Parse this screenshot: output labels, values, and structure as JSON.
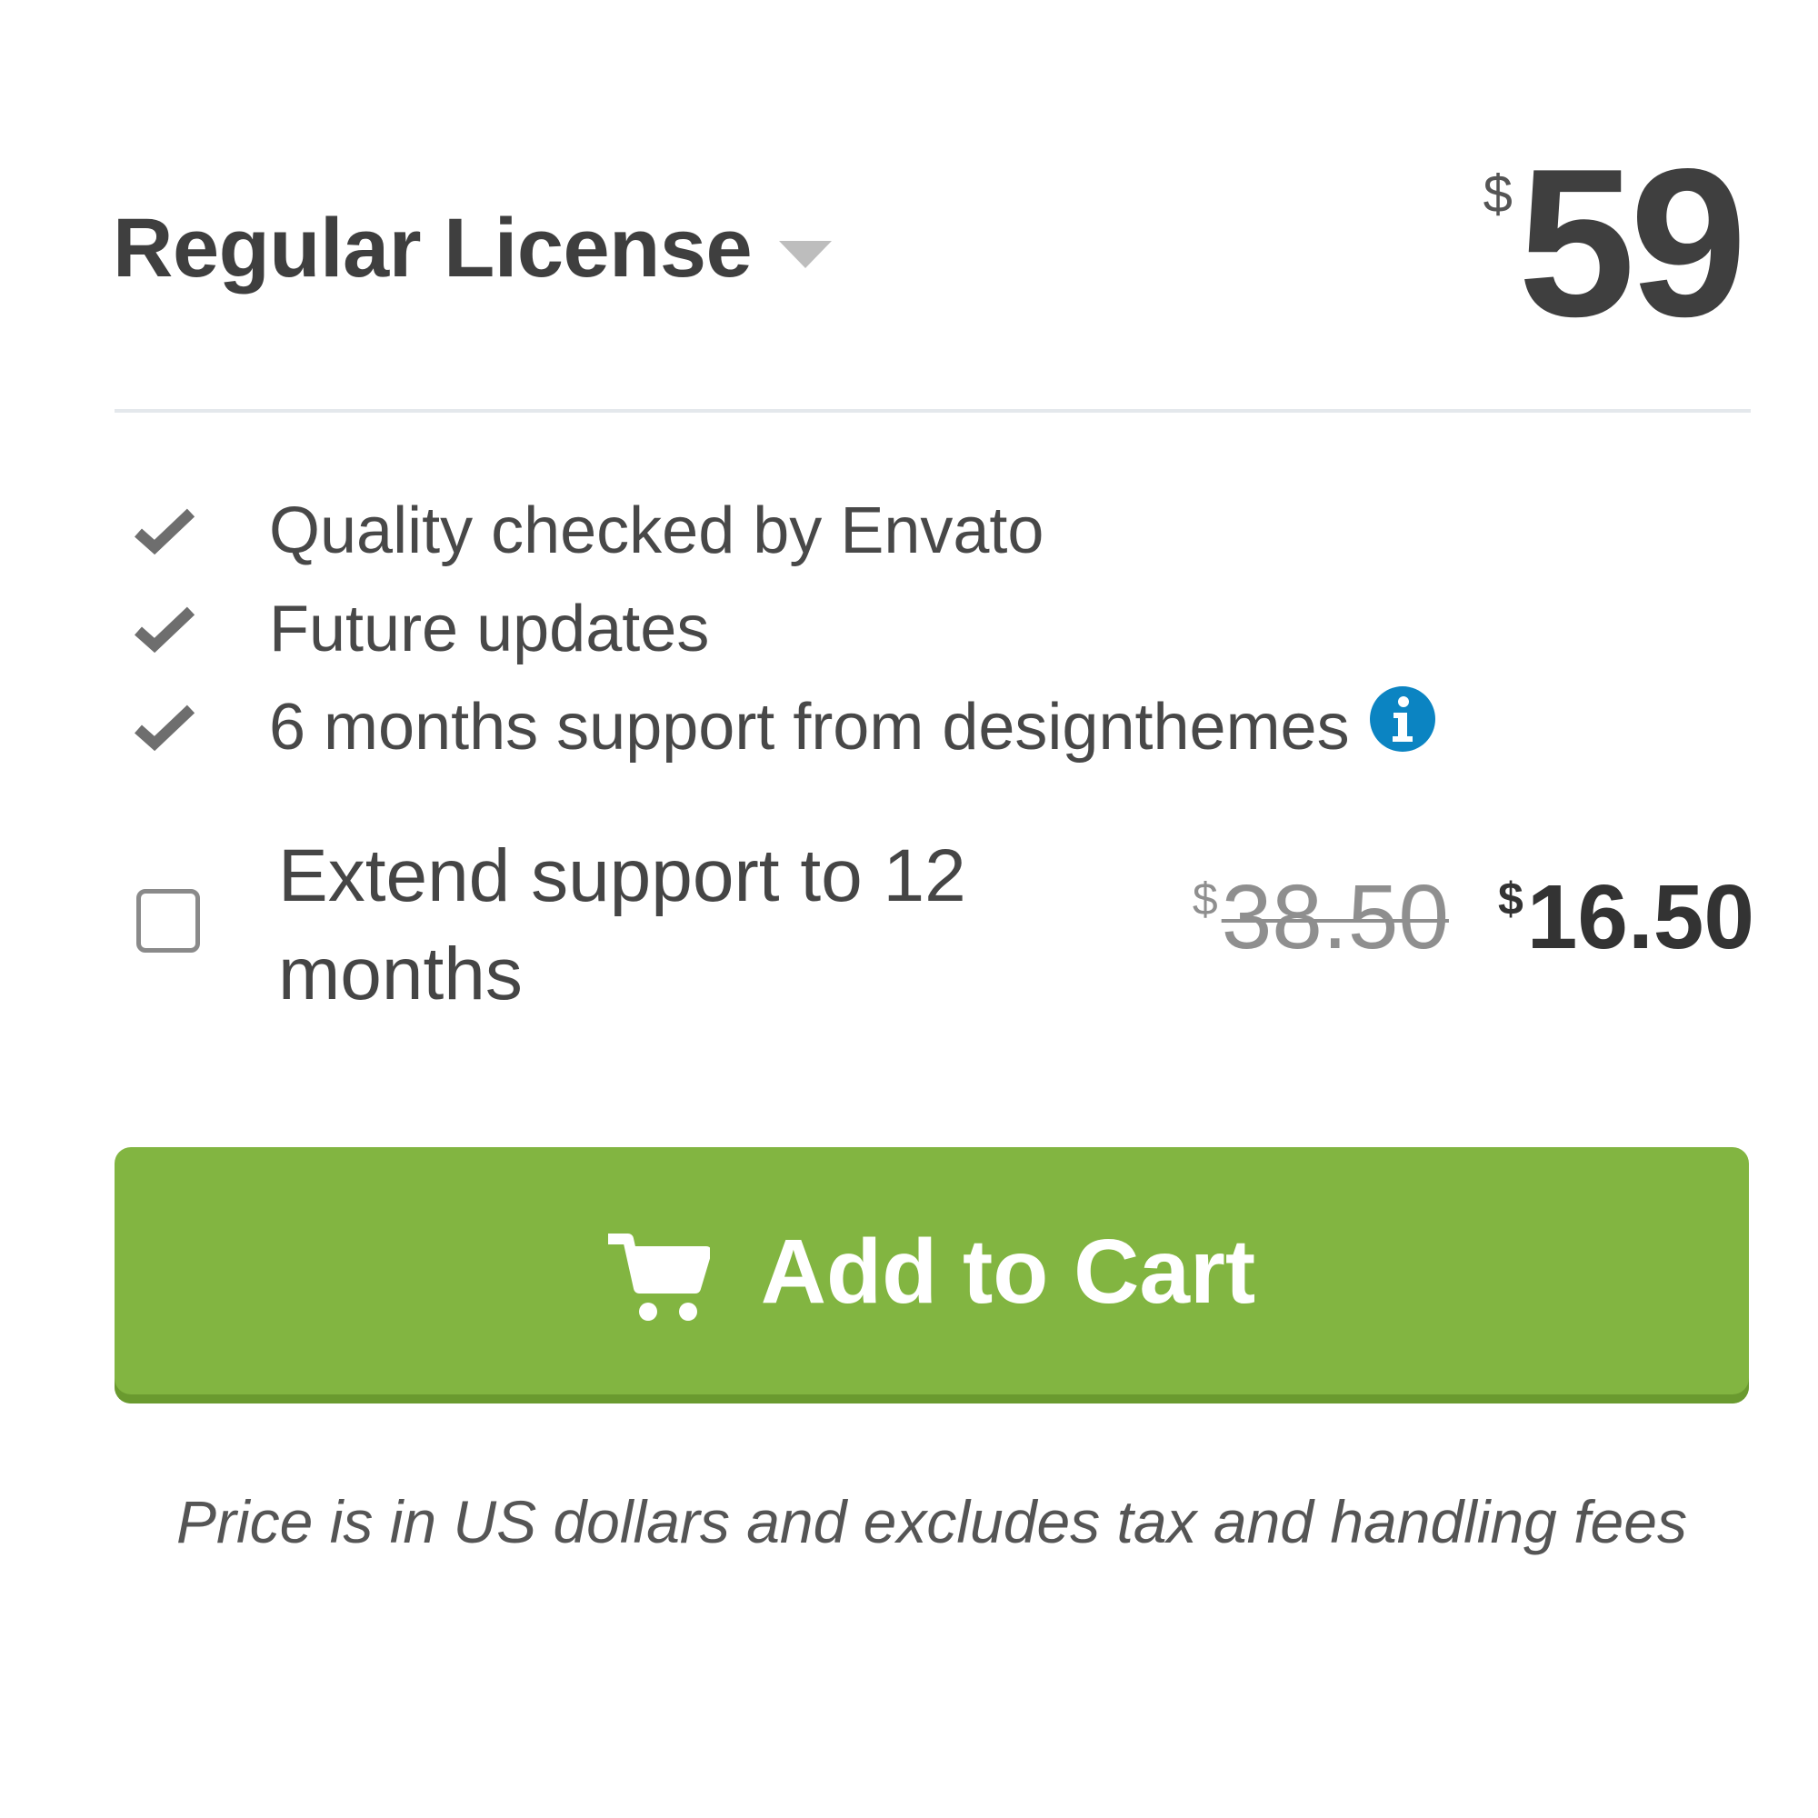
{
  "license": {
    "name": "Regular License",
    "price_currency": "$",
    "price_amount": "59"
  },
  "features": [
    {
      "text": "Quality checked by Envato",
      "icon": "checkmark-icon"
    },
    {
      "text": "Future updates",
      "icon": "checkmark-icon"
    },
    {
      "text": "6 months support from designthemes",
      "icon": "checkmark-icon",
      "has_info": true
    }
  ],
  "extend_support": {
    "label": "Extend support to 12 months",
    "checked": false,
    "old_price_currency": "$",
    "old_price": "38.50",
    "new_price_currency": "$",
    "new_price": "16.50"
  },
  "cart_button": {
    "label": "Add to Cart",
    "icon": "cart-icon"
  },
  "disclaimer": "Price is in US dollars and excludes tax and handling fees",
  "colors": {
    "button_green": "#82b541",
    "info_blue": "#0b84c2",
    "text_dark": "#3f3f3f"
  }
}
